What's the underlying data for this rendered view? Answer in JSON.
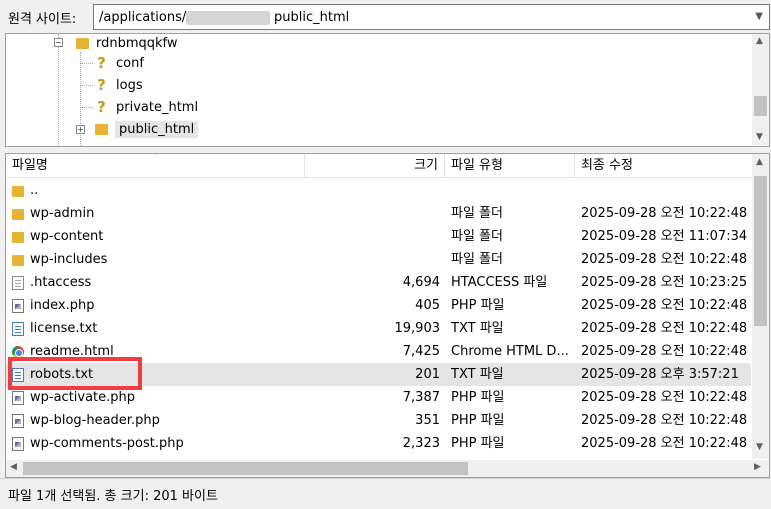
{
  "address": {
    "label": "원격 사이트:",
    "path_start": "/applications/r",
    "path_end": "public_html"
  },
  "tree": {
    "items": [
      {
        "label": "rdnbmqqkfw"
      },
      {
        "label": "conf"
      },
      {
        "label": "logs"
      },
      {
        "label": "private_html"
      },
      {
        "label": "public_html"
      }
    ]
  },
  "table": {
    "headers": {
      "name": "파일명",
      "size": "크기",
      "type": "파일 유형",
      "modified": "최종 수정"
    },
    "rows": [
      {
        "name": "..",
        "size": "",
        "type": "",
        "modified": "",
        "icon": "folder-icon"
      },
      {
        "name": "wp-admin",
        "size": "",
        "type": "파일 폴더",
        "modified": "2025-09-28 오전 10:22:48",
        "icon": "folder-icon"
      },
      {
        "name": "wp-content",
        "size": "",
        "type": "파일 폴더",
        "modified": "2025-09-28 오전 11:07:34",
        "icon": "folder-icon"
      },
      {
        "name": "wp-includes",
        "size": "",
        "type": "파일 폴더",
        "modified": "2025-09-28 오전 10:22:48",
        "icon": "folder-icon"
      },
      {
        "name": ".htaccess",
        "size": "4,694",
        "type": "HTACCESS 파일",
        "modified": "2025-09-28 오전 10:23:25",
        "icon": "file-icon"
      },
      {
        "name": "index.php",
        "size": "405",
        "type": "PHP 파일",
        "modified": "2025-09-28 오전 10:22:48",
        "icon": "php-file-icon"
      },
      {
        "name": "license.txt",
        "size": "19,903",
        "type": "TXT 파일",
        "modified": "2025-09-28 오전 10:22:48",
        "icon": "text-file-icon"
      },
      {
        "name": "readme.html",
        "size": "7,425",
        "type": "Chrome HTML D...",
        "modified": "2025-09-28 오전 10:22:48",
        "icon": "chrome-icon"
      },
      {
        "name": "robots.txt",
        "size": "201",
        "type": "TXT 파일",
        "modified": "2025-09-28 오후 3:57:21",
        "icon": "text-file-icon"
      },
      {
        "name": "wp-activate.php",
        "size": "7,387",
        "type": "PHP 파일",
        "modified": "2025-09-28 오전 10:22:48",
        "icon": "php-file-icon"
      },
      {
        "name": "wp-blog-header.php",
        "size": "351",
        "type": "PHP 파일",
        "modified": "2025-09-28 오전 10:22:48",
        "icon": "php-file-icon"
      },
      {
        "name": "wp-comments-post.php",
        "size": "2,323",
        "type": "PHP 파일",
        "modified": "2025-09-28 오전 10:22:48",
        "icon": "php-file-icon"
      }
    ]
  },
  "status": {
    "text": "파일 1개 선택됨. 총 크기: 201 바이트"
  },
  "colors": {
    "highlight": "#ef3e42",
    "folder": "#e8b331",
    "selected_row": "#e5e5e5"
  }
}
